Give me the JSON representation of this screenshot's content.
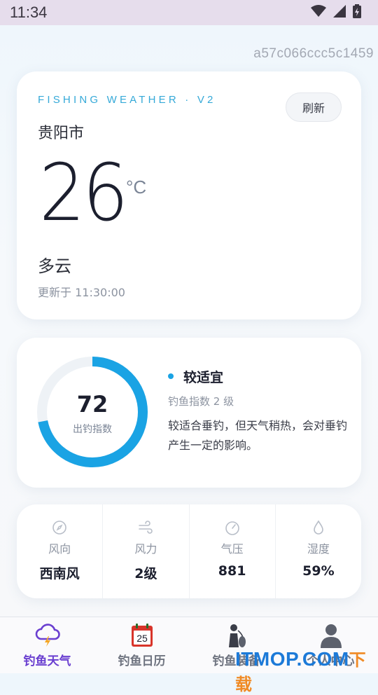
{
  "status_bar": {
    "time": "11:34"
  },
  "build_hash": "a57c066ccc5c1459",
  "weather": {
    "eyebrow": "FISHING WEATHER · V2",
    "refresh_label": "刷新",
    "city": "贵阳市",
    "temperature": "26",
    "unit": "°C",
    "condition": "多云",
    "updated": "更新于 11:30:00"
  },
  "fishing_index": {
    "value": "72",
    "value_fraction": 0.72,
    "label": "出钓指数",
    "level": "较适宜",
    "level_detail": "钓鱼指数 2 级",
    "description": "较适合垂钓，但天气稍热，会对垂钓产生一定的影响。",
    "accent_color": "#1aa3e4"
  },
  "metrics": [
    {
      "icon": "compass-icon",
      "label": "风向",
      "value": "西南风"
    },
    {
      "icon": "wind-icon",
      "label": "风力",
      "value": "2级"
    },
    {
      "icon": "gauge-icon",
      "label": "气压",
      "value": "881"
    },
    {
      "icon": "droplet-icon",
      "label": "湿度",
      "value": "59%"
    }
  ],
  "nav": [
    {
      "icon": "storm-cloud-icon",
      "label": "钓鱼天气",
      "active": true
    },
    {
      "icon": "calendar-icon",
      "label": "钓鱼日历",
      "calendar_day": "25"
    },
    {
      "icon": "fisherman-icon",
      "label": "钓鱼装备"
    },
    {
      "icon": "user-icon",
      "label": "个人中心"
    }
  ],
  "watermark": {
    "latin": "ITMOP",
    "suffix": ".COM",
    "cn": "下载"
  },
  "colors": {
    "active_tab": "#6a3fd0",
    "eyebrow": "#35a9d8"
  }
}
